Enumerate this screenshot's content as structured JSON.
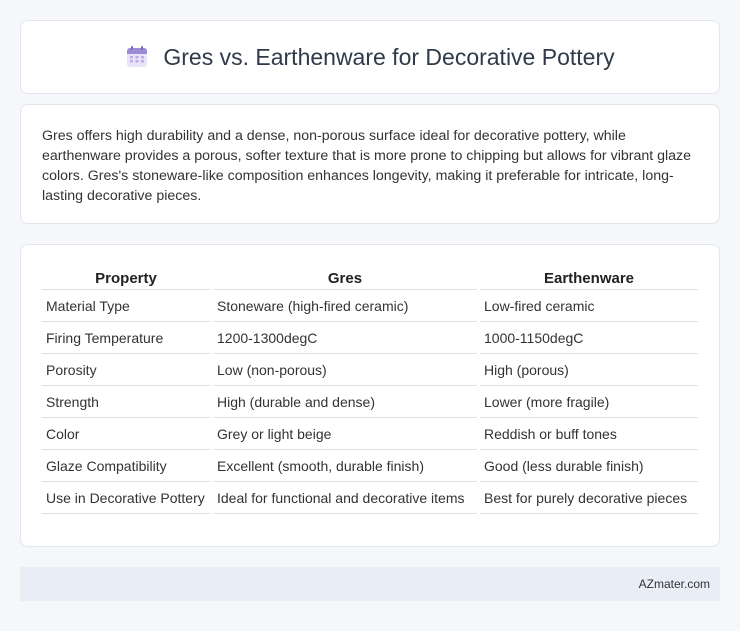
{
  "header": {
    "title": "Gres vs. Earthenware for Decorative Pottery",
    "icon": "calendar-icon"
  },
  "summary": {
    "text": "Gres offers high durability and a dense, non-porous surface ideal for decorative pottery, while earthenware provides a porous, softer texture that is more prone to chipping but allows for vibrant glaze colors. Gres's stoneware-like composition enhances longevity, making it preferable for intricate, long-lasting decorative pieces."
  },
  "table": {
    "headers": [
      "Property",
      "Gres",
      "Earthenware"
    ],
    "rows": [
      [
        "Material Type",
        "Stoneware (high-fired ceramic)",
        "Low-fired ceramic"
      ],
      [
        "Firing Temperature",
        "1200-1300degC",
        "1000-1150degC"
      ],
      [
        "Porosity",
        "Low (non-porous)",
        "High (porous)"
      ],
      [
        "Strength",
        "High (durable and dense)",
        "Lower (more fragile)"
      ],
      [
        "Color",
        "Grey or light beige",
        "Reddish or buff tones"
      ],
      [
        "Glaze Compatibility",
        "Excellent (smooth, durable finish)",
        "Good (less durable finish)"
      ],
      [
        "Use in Decorative Pottery",
        "Ideal for functional and decorative items",
        "Best for purely decorative pieces"
      ]
    ]
  },
  "footer": {
    "brand": "AZmater.com"
  }
}
